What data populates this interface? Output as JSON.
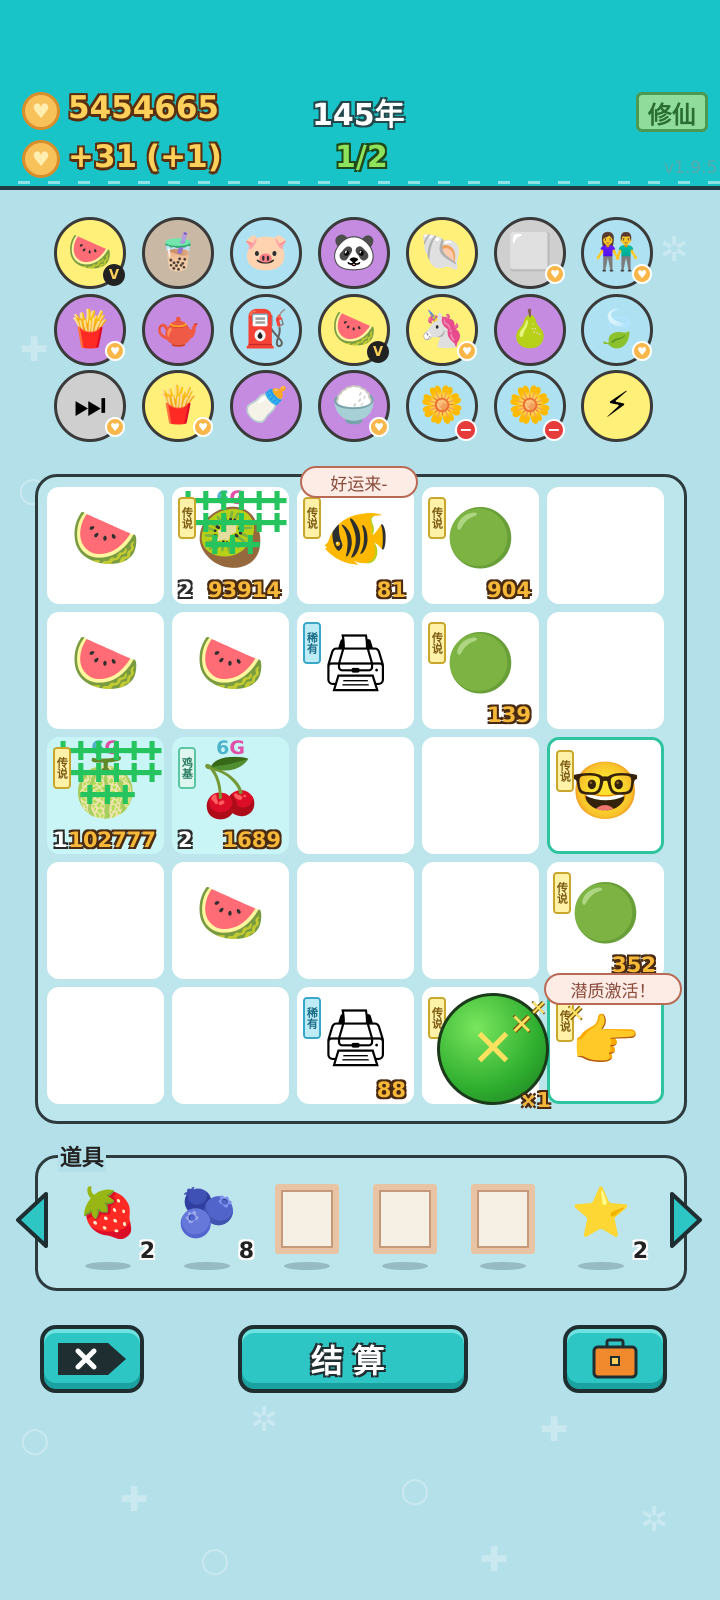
{
  "header": {
    "coins": "5454665",
    "income": "+31",
    "income_bonus": "(+1)",
    "year": "145年",
    "progress": "1/2",
    "xiuxian_button": "修仙",
    "version": "v1.9.5"
  },
  "relics": [
    {
      "icon": "🍉",
      "name": "fruit-basket-icon",
      "bg": "c-yellow",
      "badge": "v"
    },
    {
      "icon": "🧋",
      "name": "bubble-tea-icon",
      "bg": "c-tan",
      "badge": ""
    },
    {
      "icon": "🐷",
      "name": "piggy-bank-icon",
      "bg": "c-blue",
      "badge": ""
    },
    {
      "icon": "🐼",
      "name": "panda-icon",
      "bg": "c-purple",
      "badge": ""
    },
    {
      "icon": "🐚",
      "name": "shell-icon",
      "bg": "c-yellow",
      "badge": ""
    },
    {
      "icon": "⬜",
      "name": "sugar-cubes-icon",
      "bg": "c-gray",
      "badge": "heart"
    },
    {
      "icon": "👫",
      "name": "couple-icon",
      "bg": "c-blue",
      "badge": "heart"
    },
    {
      "icon": "🍟",
      "name": "fries-icon",
      "bg": "c-purple",
      "badge": "heart"
    },
    {
      "icon": "🫖",
      "name": "gravy-boat-icon",
      "bg": "c-purple",
      "badge": ""
    },
    {
      "icon": "⛽",
      "name": "air-pump-icon",
      "bg": "c-blue",
      "badge": ""
    },
    {
      "icon": "🍉",
      "name": "fruit-basket-icon",
      "bg": "c-yellow",
      "badge": "v"
    },
    {
      "icon": "🦄",
      "name": "unicorn-icon",
      "bg": "c-yellow",
      "badge": "heart"
    },
    {
      "icon": "🍐",
      "name": "pomelo-icon",
      "bg": "c-purple",
      "badge": ""
    },
    {
      "icon": "🍃",
      "name": "leaf-icon",
      "bg": "c-blue",
      "badge": "heart"
    },
    {
      "icon": "⏭",
      "name": "skip-icon",
      "bg": "c-gray",
      "badge": "heart"
    },
    {
      "icon": "🍟",
      "name": "fries-icon",
      "bg": "c-yellow",
      "badge": "heart"
    },
    {
      "icon": "🍼",
      "name": "breast-pump-icon",
      "bg": "c-purple",
      "badge": ""
    },
    {
      "icon": "🍚",
      "name": "rice-bowl-icon",
      "bg": "c-purple",
      "badge": "heart"
    },
    {
      "icon": "🌼",
      "name": "flower-pot-icon",
      "bg": "c-blue",
      "badge": "minus"
    },
    {
      "icon": "🌼",
      "name": "flower-pot-icon",
      "bg": "c-blue",
      "badge": "minus"
    },
    {
      "icon": "⚡",
      "name": "lightning-icon",
      "bg": "c-yellow",
      "badge": ""
    }
  ],
  "bubbles": {
    "lucky": "好运来-",
    "activate": "潜质激活！"
  },
  "board": [
    {
      "row": 0,
      "col": 0,
      "icon": "🍉",
      "name": "watermelon-slice-icon"
    },
    {
      "row": 0,
      "col": 1,
      "icon": "🥝",
      "name": "clover-fruit-icon",
      "sixg": true,
      "crosses": true,
      "tag": "legend",
      "tag_text": "传说",
      "level": "2",
      "count": "93914"
    },
    {
      "row": 0,
      "col": 2,
      "icon": "🐠",
      "name": "koi-fish-icon",
      "tag": "legend",
      "tag_text": "传说",
      "count": "81"
    },
    {
      "row": 0,
      "col": 3,
      "icon": "🟢",
      "name": "watermelon-icon",
      "tag": "legend",
      "tag_text": "传说",
      "count": "904"
    },
    {
      "row": 0,
      "col": 4,
      "icon": "",
      "name": "empty-slot"
    },
    {
      "row": 1,
      "col": 0,
      "icon": "🍉",
      "name": "watermelon-slice-icon"
    },
    {
      "row": 1,
      "col": 1,
      "icon": "🍉",
      "name": "watermelon-slice-icon"
    },
    {
      "row": 1,
      "col": 2,
      "icon": "🖨",
      "name": "printer-icon",
      "tag": "rare",
      "tag_text": "稀有"
    },
    {
      "row": 1,
      "col": 3,
      "icon": "🟢",
      "name": "watermelon-icon",
      "tag": "legend",
      "tag_text": "传说",
      "count": "139"
    },
    {
      "row": 1,
      "col": 4,
      "icon": "",
      "name": "empty-slot"
    },
    {
      "row": 2,
      "col": 0,
      "icon": "🍈",
      "name": "clover-fruit-icon",
      "sixg": true,
      "crosses": true,
      "tag": "legend",
      "tag_text": "传说",
      "level": "1",
      "count": "102777",
      "cyan": true
    },
    {
      "row": 2,
      "col": 1,
      "icon": "🍒",
      "name": "longan-icon",
      "sixg": true,
      "tag": "ghost",
      "tag_text": "鸡基",
      "level": "2",
      "count": "1689",
      "cyan": true
    },
    {
      "row": 2,
      "col": 2,
      "icon": "",
      "name": "empty-slot"
    },
    {
      "row": 2,
      "col": 3,
      "icon": "",
      "name": "empty-slot"
    },
    {
      "row": 2,
      "col": 4,
      "icon": "🤓",
      "name": "old-man-face-icon",
      "tag": "legend",
      "tag_text": "传说",
      "highlight": true
    },
    {
      "row": 3,
      "col": 0,
      "icon": "",
      "name": "empty-slot"
    },
    {
      "row": 3,
      "col": 1,
      "icon": "🍉",
      "name": "watermelon-slice-icon"
    },
    {
      "row": 3,
      "col": 2,
      "icon": "",
      "name": "empty-slot"
    },
    {
      "row": 3,
      "col": 3,
      "icon": "",
      "name": "empty-slot"
    },
    {
      "row": 3,
      "col": 4,
      "icon": "🟢",
      "name": "watermelon-icon",
      "tag": "legend",
      "tag_text": "传说",
      "count": "352"
    },
    {
      "row": 4,
      "col": 0,
      "icon": "",
      "name": "empty-slot"
    },
    {
      "row": 4,
      "col": 1,
      "icon": "",
      "name": "empty-slot"
    },
    {
      "row": 4,
      "col": 2,
      "icon": "🖨",
      "name": "printer-icon",
      "tag": "rare",
      "tag_text": "稀有",
      "count": "88"
    },
    {
      "row": 4,
      "col": 3,
      "icon": "",
      "name": "watermelon-slot",
      "tag": "legend",
      "tag_text": "传说"
    },
    {
      "row": 4,
      "col": 4,
      "icon": "👉",
      "name": "pointing-hand-icon",
      "tag": "legend",
      "tag_text": "传说",
      "highlight": true
    }
  ],
  "big_melon": {
    "mark": "✕",
    "count": "×1"
  },
  "tools": {
    "label": "道具",
    "items": [
      {
        "icon": "🍓",
        "name": "lychee-icon",
        "count": "2"
      },
      {
        "icon": "🫐",
        "name": "blueberry-icon",
        "count": "8"
      },
      {
        "icon": "",
        "name": "empty-frame",
        "count": ""
      },
      {
        "icon": "",
        "name": "empty-frame",
        "count": ""
      },
      {
        "icon": "",
        "name": "empty-frame",
        "count": ""
      },
      {
        "icon": "⭐",
        "name": "star-icon",
        "count": "2"
      }
    ]
  },
  "buttons": {
    "settle": "结算"
  }
}
